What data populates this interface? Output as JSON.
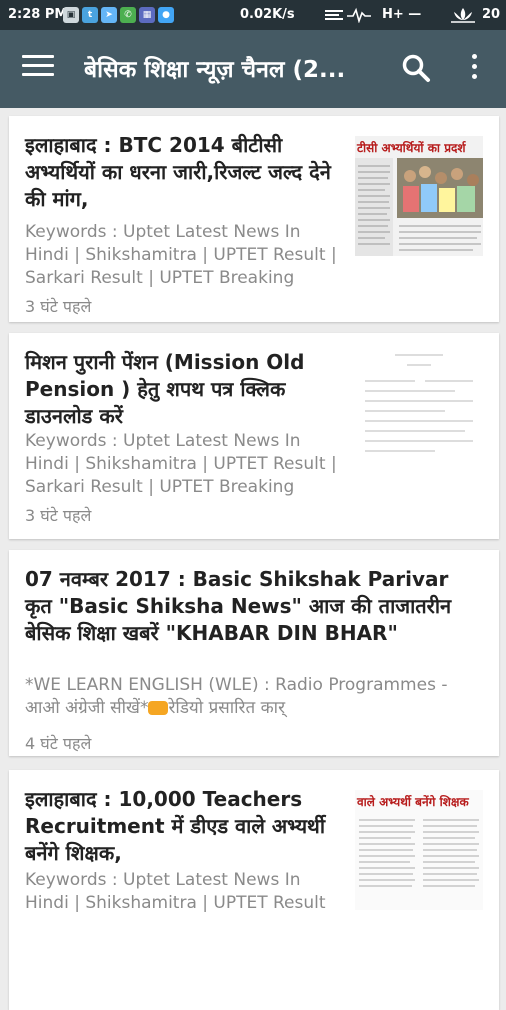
{
  "status_bar": {
    "time": "2:28 PM",
    "net_speed": "0.02K/s",
    "network_type": "H+ —",
    "battery": "20"
  },
  "app_bar": {
    "title": "बेसिक शिक्षा न्यूज़ चैनल (2..."
  },
  "articles": [
    {
      "headline": "इलाहाबाद : BTC 2014 बीटीसी अभ्यर्थियों का धरना जारी,रिजल्ट जल्द देने की मांग,",
      "keywords": "Keywords : Uptet Latest News In Hindi | Shikshamitra | UPTET Result | Sarkari Result | UPTET Breaking",
      "time": "3 घंटे पहले",
      "thumb_caption": "टीसी अभ्यर्थियों का प्रदर्श"
    },
    {
      "headline": "मिशन पुरानी पेंशन (Mission Old Pension ) हेतु शपथ पत्र क्लिक डाउनलोड करें",
      "keywords": "Keywords : Uptet Latest News In Hindi | Shikshamitra | UPTET Result | Sarkari Result | UPTET Breaking",
      "time": "3 घंटे पहले"
    },
    {
      "headline": "07 नवम्बर 2017 : Basic Shikshak Parivar कृत \"Basic Shiksha News\" आज की ताजातरीन  बेसिक शिक्षा खबरें \"KHABAR DIN BHAR\"",
      "snippet_line1": "*WE LEARN ENGLISH  (WLE) : Radio Programmes -",
      "snippet_line2_a": "आओ अंग्रेजी सीखें*",
      "snippet_line2_b": "रेडियो प्रसारित कार्",
      "time": "4 घंटे पहले"
    },
    {
      "headline": "इलाहाबाद : 10,000 Teachers Recruitment में डीएड वाले अभ्यर्थी बनेंगे शिक्षक,",
      "keywords": "Keywords : Uptet Latest News In Hindi | Shikshamitra | UPTET Result",
      "thumb_caption": "वाले अभ्यर्थी बनेंगे शिक्षक"
    }
  ]
}
